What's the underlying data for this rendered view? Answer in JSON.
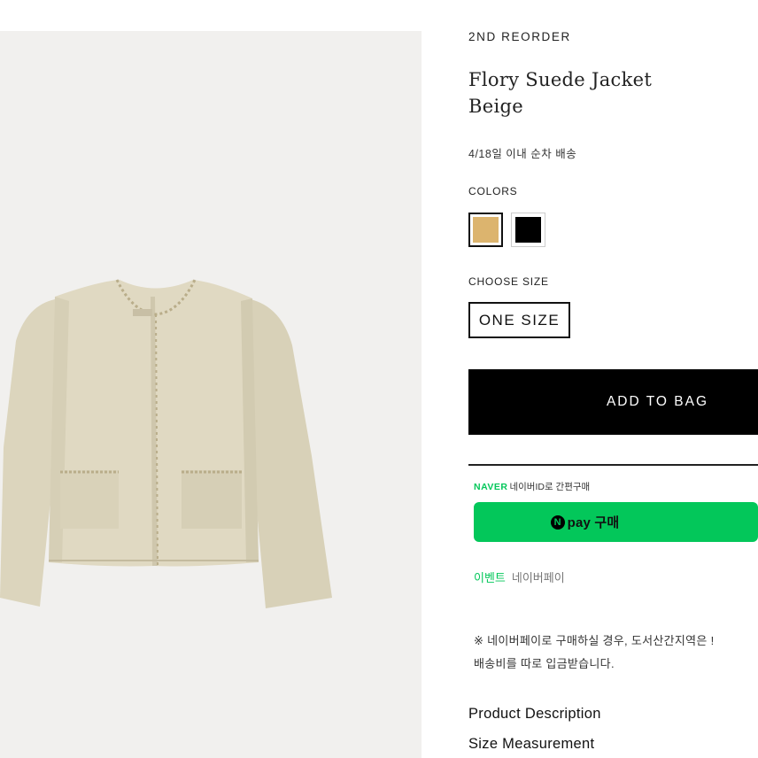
{
  "product": {
    "brand": "2ND REORDER",
    "title_line1": "Flory Suede Jacket",
    "title_line2": "Beige",
    "shipping_note": "4/18일 이내 순차 배송",
    "image_icon": "product-photo-beige-jacket"
  },
  "colors": {
    "label": "COLORS",
    "options": [
      {
        "name": "beige",
        "hex": "#dcb46e",
        "selected": true
      },
      {
        "name": "black",
        "hex": "#000000",
        "selected": false
      }
    ]
  },
  "size": {
    "label": "CHOOSE SIZE",
    "selected": "ONE SIZE"
  },
  "cart": {
    "add_label": "ADD TO BAG"
  },
  "naver": {
    "brand": "NAVER",
    "subtitle": "네이버ID로 간편구매",
    "pay_n": "N",
    "pay_label": "pay 구매",
    "accent": "#03c75a",
    "event_tag": "이벤트",
    "event_text": "네이버페이",
    "notice_line1": "※ 네이버페이로 구매하실 경우, 도서산간지역은 !",
    "notice_line2": "배송비를 따로 입금받습니다."
  },
  "links": {
    "description": "Product Description",
    "measurement": "Size Measurement"
  }
}
